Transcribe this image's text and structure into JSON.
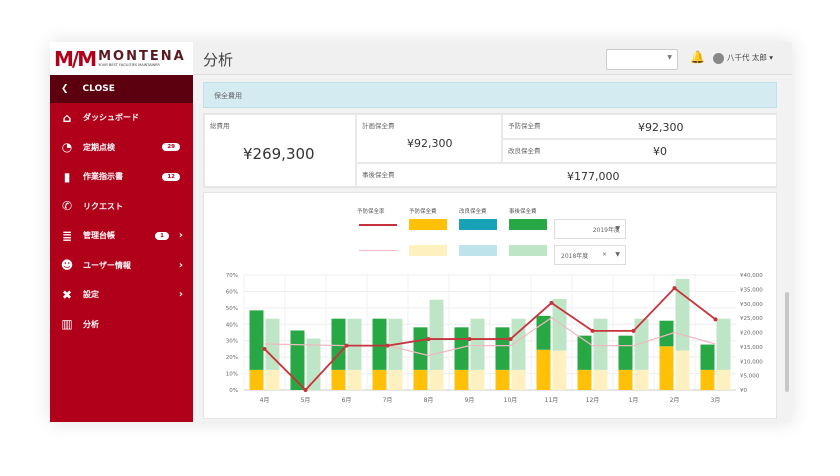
{
  "brand": {
    "logo_mark": "M",
    "name": "MONTENA",
    "tagline": "YOUR BEST FACILITIES MAINTAINER"
  },
  "sidebar": {
    "close_label": "CLOSE",
    "items": [
      {
        "label": "ダッシュボード",
        "icon": "home-icon"
      },
      {
        "label": "定期点検",
        "icon": "gauge-icon",
        "badge": "29"
      },
      {
        "label": "作業指示書",
        "icon": "clipboard-icon",
        "badge": "12"
      },
      {
        "label": "リクエスト",
        "icon": "phone-icon"
      },
      {
        "label": "管理台帳",
        "icon": "database-icon",
        "badge": "1",
        "chevron": true
      },
      {
        "label": "ユーザー情報",
        "icon": "users-icon",
        "chevron": true
      },
      {
        "label": "設定",
        "icon": "tools-icon",
        "chevron": true
      },
      {
        "label": "分析",
        "icon": "chart-icon"
      }
    ]
  },
  "header": {
    "title": "分析",
    "user_name": "八千代 太郎"
  },
  "info_bar": "保全費用",
  "summary": {
    "total_label": "総費用",
    "total_value": "¥269,300",
    "planned_label": "計画保全費",
    "planned_value": "¥92,300",
    "preventive_label": "予防保全費",
    "preventive_value": "¥92,300",
    "improvement_label": "改良保全費",
    "improvement_value": "¥0",
    "accident_label": "事後保全費",
    "accident_value": "¥177,000"
  },
  "legend": {
    "rate": "予防保全率",
    "preventive": "予防保全費",
    "improvement": "改良保全費",
    "accident": "事後保全費",
    "year_current": "2019年度",
    "year_prev": "2018年度",
    "clear": "×"
  },
  "colors": {
    "brand": "#b0001a",
    "preventive": "#ffc107",
    "improvement": "#17a2b8",
    "accident": "#28a745",
    "rate": "#c8323c",
    "rate_prev": "#f0b8c0"
  },
  "chart_data": {
    "type": "bar",
    "categories": [
      "4月",
      "5月",
      "6月",
      "7月",
      "8月",
      "9月",
      "10月",
      "11月",
      "12月",
      "1月",
      "2月",
      "3月"
    ],
    "left_axis": {
      "ylim": [
        0,
        70
      ],
      "ticks": [
        "0%",
        "10%",
        "20%",
        "30%",
        "40%",
        "50%",
        "60%",
        "70%"
      ]
    },
    "right_axis": {
      "ylim": [
        0,
        40000
      ],
      "ticks": [
        "¥0",
        "¥5,000",
        "¥10,000",
        "¥15,000",
        "¥20,000",
        "¥25,000",
        "¥30,000",
        "¥35,000",
        "¥40,000"
      ]
    },
    "series": [
      {
        "name": "予防保全費 2019",
        "stack": "2019",
        "values": [
          7000,
          0,
          7000,
          7000,
          7000,
          7000,
          7000,
          14000,
          7000,
          7000,
          15200,
          7000
        ]
      },
      {
        "name": "事後保全費 2019",
        "stack": "2019",
        "values": [
          20700,
          20700,
          17800,
          17800,
          14800,
          14800,
          14800,
          11800,
          11900,
          11900,
          8900,
          8800
        ]
      },
      {
        "name": "予防保全費 2018",
        "stack": "2018",
        "values": [
          7000,
          0,
          7000,
          7000,
          7000,
          7000,
          7000,
          13700,
          7000,
          7000,
          13700,
          7000
        ]
      },
      {
        "name": "事後保全費 2018",
        "stack": "2018",
        "values": [
          17800,
          17900,
          17800,
          17800,
          24400,
          17800,
          17800,
          18000,
          17800,
          17800,
          24900,
          17800
        ]
      },
      {
        "name": "予防保全率 2019",
        "axis": "left",
        "values": [
          25,
          0,
          27,
          27,
          31,
          31,
          31,
          53,
          36,
          36,
          62,
          43
        ]
      },
      {
        "name": "予防保全率 2018",
        "axis": "left",
        "values": [
          28,
          null,
          27,
          27,
          21,
          27,
          27,
          44,
          27,
          27,
          35,
          28
        ]
      }
    ]
  }
}
